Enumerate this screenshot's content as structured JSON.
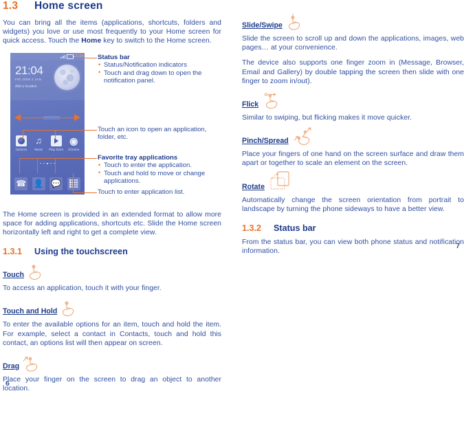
{
  "left_column": {
    "heading": {
      "number": "1.3",
      "title": "Home screen"
    },
    "intro_paragraph_part1": "You can bring all the items (applications, shortcuts, folders and widgets) you love or use most frequently to your Home screen for quick access. Touch the ",
    "intro_paragraph_bold": "Home",
    "intro_paragraph_part2": " key to switch to the Home screen.",
    "figure": {
      "phone": {
        "status_bar": {
          "time": "21:04",
          "signal_icon": "signal-bars-icon",
          "battery_icon": "battery-icon"
        },
        "widget": {
          "clock": "21:04",
          "date": "FRI  2009 2 JAN",
          "location_prompt": "Add a location",
          "moon_icon": "moon-icon"
        },
        "apps": [
          {
            "label": "Camera",
            "icon": "camera-icon"
          },
          {
            "label": "Music",
            "icon": "music-note-icon"
          },
          {
            "label": "Play Store",
            "icon": "play-store-icon"
          },
          {
            "label": "Chrome",
            "icon": "chrome-icon"
          }
        ],
        "dock": [
          {
            "label": "Phone",
            "icon": "phone-handset-icon"
          },
          {
            "label": "Contacts",
            "icon": "contact-person-icon"
          },
          {
            "label": "Messaging",
            "icon": "message-bubble-icon"
          },
          {
            "label": "Application list",
            "icon": "app-grid-icon"
          }
        ]
      },
      "callouts": {
        "status_bar": {
          "title": "Status bar",
          "bullets": [
            "Status/Notification indicators",
            "Touch and drag down to open the notification panel."
          ]
        },
        "icon_note": "Touch an icon to open an application, folder, etc.",
        "favorite_tray": {
          "title": "Favorite tray applications",
          "bullets": [
            "Touch to enter the application.",
            "Touch and hold to move or change applications."
          ]
        },
        "app_list_note": "Touch to enter application list."
      }
    },
    "extended_paragraph": "The Home screen is provided in an extended format to allow more space for adding applications, shortcuts etc. Slide the Home screen horizontally left and right to get a complete view.",
    "subheading_touchscreen": {
      "number": "1.3.1",
      "title": "Using the touchscreen"
    },
    "gestures": [
      {
        "title": "Touch",
        "icon": "hand-touch-icon",
        "paragraphs": [
          "To access an application, touch it with your finger."
        ]
      },
      {
        "title": "Touch and Hold",
        "icon": "hand-touch-hold-icon",
        "paragraphs": [
          "To enter the available options for an item, touch and hold the item. For example, select a contact in Contacts, touch and hold this contact, an options list will then appear on screen."
        ]
      },
      {
        "title": "Drag",
        "icon": "hand-drag-icon",
        "paragraphs": [
          "Place your finger on the screen to drag an object to another location."
        ]
      }
    ],
    "page_number": "6"
  },
  "right_column": {
    "gestures": [
      {
        "title": "Slide/Swipe",
        "icon": "hand-slide-icon",
        "paragraphs": [
          "Slide the screen to scroll up and down the applications, images, web pages… at your convenience.",
          "The device also supports one finger zoom in (Message, Browser, Email and Gallery) by double tapping the screen then slide with one finger to zoom in/out)."
        ]
      },
      {
        "title": "Flick",
        "icon": "hand-flick-icon",
        "paragraphs": [
          "Similar to swiping, but flicking makes it move quicker."
        ]
      },
      {
        "title": "Pinch/Spread",
        "icon": "hand-pinch-spread-icon",
        "paragraphs": [
          "Place your fingers of one hand on the screen surface and draw them apart or together to scale an element on the screen."
        ]
      },
      {
        "title": "Rotate",
        "icon": "phone-rotate-icon",
        "paragraphs": [
          "Automatically change the screen orientation from portrait to landscape by turning the phone sideways to have a better view."
        ]
      }
    ],
    "subheading_status_bar": {
      "number": "1.3.2",
      "title": "Status bar"
    },
    "status_bar_paragraph": "From the status bar, you can view both phone status and notification information.",
    "page_number": "7"
  },
  "colors": {
    "accent_orange": "#e8712b",
    "heading_blue": "#1d3b8b",
    "body_blue": "#2f4ea0",
    "phone_screen_blue": "#6476bd"
  }
}
